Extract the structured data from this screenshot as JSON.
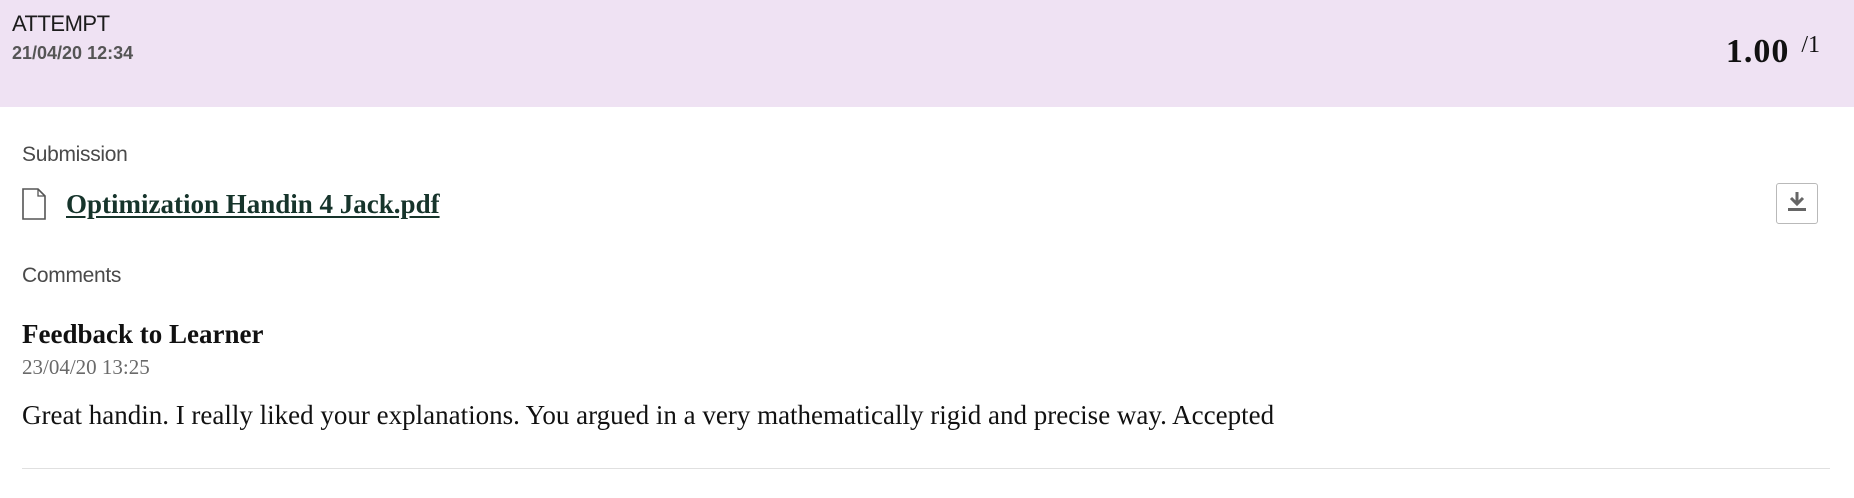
{
  "attempt": {
    "label": "ATTEMPT",
    "date": "21/04/20 12:34",
    "score": "1.00",
    "score_max": "/1"
  },
  "submission": {
    "label": "Submission",
    "file_name": "Optimization Handin 4 Jack.pdf",
    "file_icon": "document-icon",
    "download_icon": "download-icon"
  },
  "comments": {
    "label": "Comments",
    "feedback": {
      "title": "Feedback to Learner",
      "date": "23/04/20 13:25",
      "text": "Great handin. I really liked your explanations. You argued in a very mathematically rigid and precise way. Accepted"
    }
  },
  "colors": {
    "header_bg": "#efe2f3",
    "link": "#16342b",
    "muted": "#6a6a6a"
  }
}
